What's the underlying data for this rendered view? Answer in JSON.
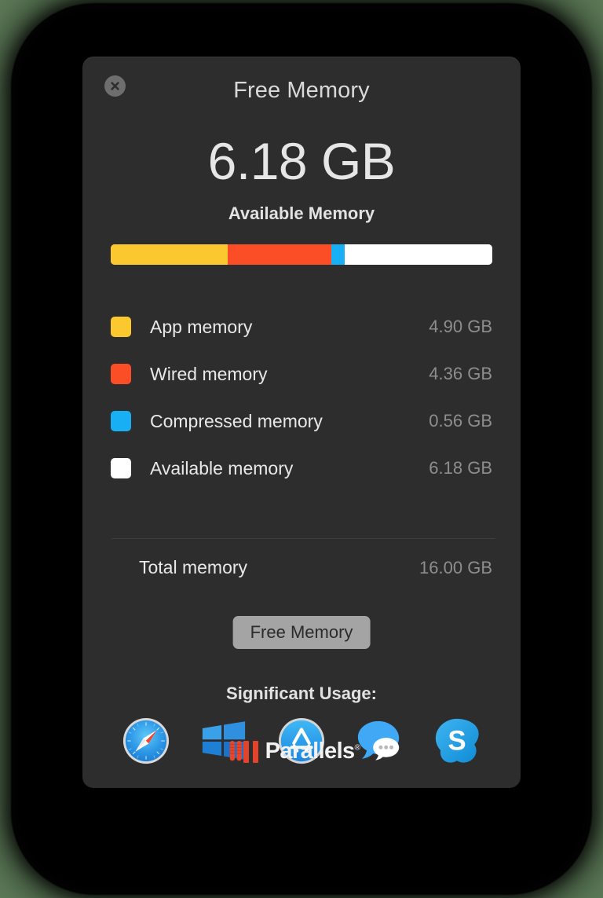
{
  "window": {
    "title": "Free Memory",
    "close_label": "Close",
    "close_icon": "close-x-icon"
  },
  "summary": {
    "value": "6.18 GB",
    "caption": "Available Memory"
  },
  "chart_data": {
    "type": "bar",
    "title": "Free Memory",
    "categories": [
      "App memory",
      "Wired memory",
      "Compressed memory",
      "Available memory"
    ],
    "values": [
      4.9,
      4.36,
      0.56,
      6.18
    ],
    "value_labels": [
      "4.90 GB",
      "4.36 GB",
      "0.56 GB",
      "6.18 GB"
    ],
    "colors": [
      "#FBC82F",
      "#FB4E26",
      "#18AFF4",
      "#FFFFFF"
    ],
    "unit": "GB",
    "total": 16.0,
    "total_label": "16.00 GB",
    "xlabel": "",
    "ylabel": "",
    "legend_position": "below",
    "stacked": true
  },
  "bar_segments": [
    {
      "name": "app-memory",
      "color": "#FBC82F",
      "percent": 30.65
    },
    {
      "name": "wired-memory",
      "color": "#FB4E26",
      "percent": 27.25
    },
    {
      "name": "compressed-memory",
      "color": "#18AFF4",
      "percent": 3.5
    },
    {
      "name": "available-memory",
      "color": "#FFFFFF",
      "percent": 38.6
    }
  ],
  "legend": [
    {
      "color": "#FBC82F",
      "label": "App memory",
      "value": "4.90 GB"
    },
    {
      "color": "#FB4E26",
      "label": "Wired memory",
      "value": "4.36 GB"
    },
    {
      "color": "#18AFF4",
      "label": "Compressed memory",
      "value": "0.56 GB"
    },
    {
      "color": "#FFFFFF",
      "label": "Available memory",
      "value": "6.18 GB"
    }
  ],
  "total": {
    "label": "Total memory",
    "value": "16.00 GB"
  },
  "action": {
    "free_memory_label": "Free Memory"
  },
  "usage": {
    "title": "Significant Usage:",
    "apps": [
      {
        "name": "safari",
        "icon": "safari-icon"
      },
      {
        "name": "windows-vm",
        "icon": "windows-parallels-icon"
      },
      {
        "name": "app-store",
        "icon": "app-store-icon"
      },
      {
        "name": "messages",
        "icon": "messages-icon"
      },
      {
        "name": "skype",
        "icon": "skype-icon"
      }
    ]
  },
  "branding": {
    "name": "Parallels",
    "registered_mark": "®",
    "accent_color": "#E3422B"
  }
}
